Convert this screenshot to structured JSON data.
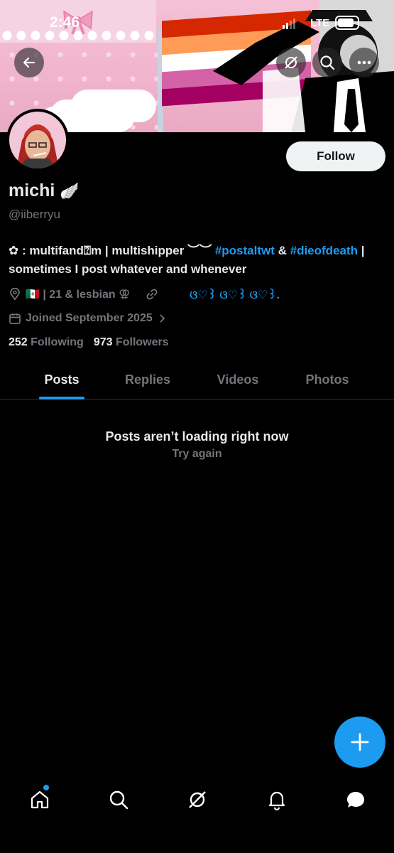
{
  "status_bar": {
    "time": "2:46",
    "network": "LTE"
  },
  "banner": {
    "flag_colors": [
      "#d62800",
      "#ff9b56",
      "#ffffff",
      "#d462a6",
      "#a40062"
    ]
  },
  "header_buttons": {
    "back": "back-arrow-icon",
    "grok": "grok-icon",
    "search": "search-icon",
    "more": "more-icon"
  },
  "profile": {
    "follow_label": "Follow",
    "name": "michi",
    "name_emoji": "🪽",
    "handle": "@iiberryu",
    "bio_prefix": "✿ :  multifand⍰m | multishipper ︶︶ ",
    "bio_tag1": "#postaltwt",
    "bio_mid": " & ",
    "bio_tag2": "#dieofdeath",
    "bio_suffix": " | sometimes I post whatever and whenever",
    "location": "🇲🇽 | 21 & lesbian ⚢",
    "link_text": "ଓ♡꒱   ଓ♡꒱   ଓ♡꒱.",
    "joined": "Joined September 2025",
    "following_count": "252",
    "following_label": "Following",
    "followers_count": "973",
    "followers_label": "Followers"
  },
  "tabs": [
    "Posts",
    "Replies",
    "Videos",
    "Photos"
  ],
  "active_tab": "Posts",
  "empty_state": {
    "title": "Posts aren’t loading right now",
    "retry": "Try again"
  },
  "colors": {
    "accent": "#1d9bf0",
    "muted": "#71767b",
    "text": "#e7e9ea",
    "background": "#000000"
  }
}
